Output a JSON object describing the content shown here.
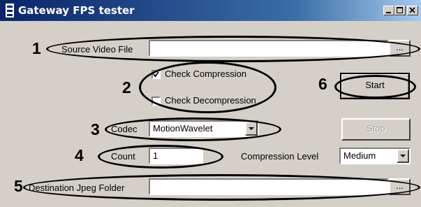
{
  "window": {
    "title": "Gateway FPS tester"
  },
  "icons": {
    "app": "app-icon",
    "minimize": "minimize-icon",
    "maximize": "maximize-icon",
    "close": "close-icon",
    "dropdown": "chevron-down-icon"
  },
  "annotations": [
    "1",
    "2",
    "3",
    "4",
    "5",
    "6"
  ],
  "source": {
    "label": "Source Video File",
    "value": "",
    "browse_label": "..."
  },
  "check_compression": {
    "label": "Check Compression",
    "checked": true
  },
  "check_decompression": {
    "label": "Check Decompression",
    "checked": false
  },
  "codec": {
    "label": "Codec",
    "value": "MotionWavelet"
  },
  "count": {
    "label": "Count",
    "value": "1"
  },
  "compression_level": {
    "label": "Compression Level",
    "value": "Medium"
  },
  "start": {
    "label": "Start"
  },
  "stop": {
    "label": "Stop",
    "enabled": false
  },
  "destination": {
    "label": "Destination Jpeg Folder",
    "value": "",
    "browse_label": "..."
  }
}
